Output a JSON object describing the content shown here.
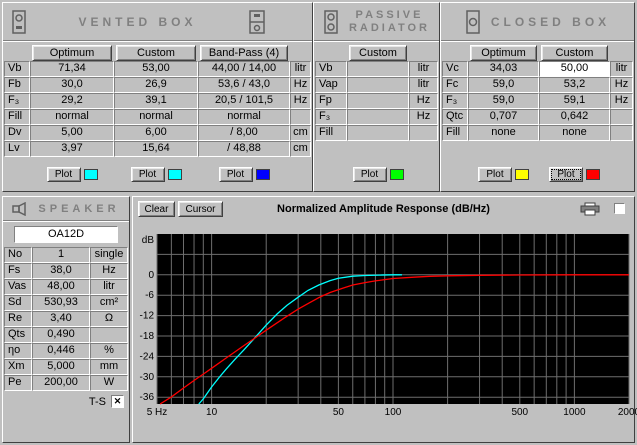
{
  "vented": {
    "title": "VENTED BOX",
    "col_buttons": [
      "Optimum",
      "Custom",
      "Band-Pass (4)"
    ],
    "rows": [
      {
        "label": "Vb",
        "v": [
          "71,34",
          "53,00",
          "44,00 / 14,00"
        ],
        "unit": "litr"
      },
      {
        "label": "Fb",
        "v": [
          "30,0",
          "26,9",
          "53,6 / 43,0"
        ],
        "unit": "Hz"
      },
      {
        "label": "F₃",
        "v": [
          "29,2",
          "39,1",
          "20,5 / 101,5"
        ],
        "unit": "Hz"
      },
      {
        "label": "Fill",
        "v": [
          "normal",
          "normal",
          "normal"
        ],
        "unit": ""
      },
      {
        "label": "Dv",
        "v": [
          "5,00",
          "6,00",
          "/ 8,00"
        ],
        "unit": "cm"
      },
      {
        "label": "Lv",
        "v": [
          "3,97",
          "15,64",
          "/ 48,88"
        ],
        "unit": "cm"
      }
    ],
    "plot_label": "Plot",
    "plot_colors": [
      "#00ffff",
      "#00ffff",
      "#0000ff"
    ]
  },
  "passive": {
    "title_line1": "PASSIVE",
    "title_line2": "RADIATOR",
    "col_buttons": [
      "Custom"
    ],
    "rows": [
      {
        "label": "Vb",
        "v": [
          ""
        ],
        "unit": "litr"
      },
      {
        "label": "Vap",
        "v": [
          ""
        ],
        "unit": "litr"
      },
      {
        "label": "Fp",
        "v": [
          ""
        ],
        "unit": "Hz"
      },
      {
        "label": "F₃",
        "v": [
          ""
        ],
        "unit": "Hz"
      },
      {
        "label": "Fill",
        "v": [
          ""
        ],
        "unit": ""
      }
    ],
    "plot_label": "Plot",
    "plot_colors": [
      "#00ff00"
    ]
  },
  "closed": {
    "title": "CLOSED BOX",
    "col_buttons": [
      "Optimum",
      "Custom"
    ],
    "rows": [
      {
        "label": "Vc",
        "v": [
          "34,03",
          "50,00"
        ],
        "unit": "litr"
      },
      {
        "label": "Fc",
        "v": [
          "59,0",
          "53,2"
        ],
        "unit": "Hz"
      },
      {
        "label": "F₃",
        "v": [
          "59,0",
          "59,1"
        ],
        "unit": "Hz"
      },
      {
        "label": "Qtc",
        "v": [
          "0,707",
          "0,642"
        ],
        "unit": ""
      },
      {
        "label": "Fill",
        "v": [
          "none",
          "none"
        ],
        "unit": ""
      }
    ],
    "plot_label": "Plot",
    "plot_colors": [
      "#ffff00",
      "#ff0000"
    ]
  },
  "speaker": {
    "title": "SPEAKER",
    "name": "OA12D",
    "rows": [
      {
        "label": "No",
        "v": "1",
        "unit": "single"
      },
      {
        "label": "Fs",
        "v": "38,0",
        "unit": "Hz"
      },
      {
        "label": "Vas",
        "v": "48,00",
        "unit": "litr"
      },
      {
        "label": "Sd",
        "v": "530,93",
        "unit": "cm²"
      },
      {
        "label": "Re",
        "v": "3,40",
        "unit": "Ω"
      },
      {
        "label": "Qts",
        "v": "0,490",
        "unit": ""
      },
      {
        "label": "ηo",
        "v": "0,446",
        "unit": "%"
      },
      {
        "label": "Xm",
        "v": "5,000",
        "unit": "mm"
      },
      {
        "label": "Pe",
        "v": "200,00",
        "unit": "W"
      }
    ],
    "ts_label": "T-S",
    "ts_checked": "✕"
  },
  "graph": {
    "clear_label": "Clear",
    "cursor_label": "Cursor"
  },
  "chart_data": {
    "type": "line",
    "title": "Normalized Amplitude Response (dB/Hz)",
    "ylabel": "dB",
    "xscale": "log",
    "xlim": [
      5,
      2000
    ],
    "ylim": [
      -38,
      12
    ],
    "yticks": [
      0,
      -6,
      -12,
      -18,
      -24,
      -30,
      -36
    ],
    "xticks": [
      {
        "v": 5,
        "label": "5 Hz"
      },
      {
        "v": 10,
        "label": "10"
      },
      {
        "v": 50,
        "label": "50"
      },
      {
        "v": 100,
        "label": "100"
      },
      {
        "v": 500,
        "label": "500"
      },
      {
        "v": 1000,
        "label": "1000"
      },
      {
        "v": 2000,
        "label": "2000"
      }
    ],
    "grid": true,
    "plot_bg": "#000000",
    "grid_color": "#6e6e6e",
    "legend_position": "none",
    "series": [
      {
        "name": "vented-box-response",
        "color": "#00ffff",
        "points": [
          [
            8.5,
            -38
          ],
          [
            9,
            -36.5
          ],
          [
            10,
            -33
          ],
          [
            11,
            -30.2
          ],
          [
            12,
            -27.8
          ],
          [
            13.5,
            -24.8
          ],
          [
            15,
            -22.2
          ],
          [
            17,
            -19
          ],
          [
            20,
            -14.8
          ],
          [
            23,
            -11.5
          ],
          [
            26,
            -9
          ],
          [
            30,
            -6.6
          ],
          [
            34,
            -4.6
          ],
          [
            39,
            -3
          ],
          [
            45,
            -1.7
          ],
          [
            50,
            -1
          ],
          [
            60,
            -0.4
          ],
          [
            70,
            -0.2
          ],
          [
            85,
            -0.1
          ],
          [
            100,
            0
          ],
          [
            112,
            0
          ]
        ]
      },
      {
        "name": "closed-box-response",
        "color": "#ff0000",
        "points": [
          [
            5.2,
            -38
          ],
          [
            6,
            -35.9
          ],
          [
            7,
            -33.3
          ],
          [
            8,
            -31.1
          ],
          [
            9,
            -29.2
          ],
          [
            10,
            -27.5
          ],
          [
            12,
            -24.5
          ],
          [
            15,
            -20.9
          ],
          [
            18,
            -18
          ],
          [
            20,
            -16.3
          ],
          [
            25,
            -12.8
          ],
          [
            30,
            -10.1
          ],
          [
            35,
            -8.1
          ],
          [
            40,
            -6.4
          ],
          [
            45,
            -5.2
          ],
          [
            53,
            -3.9
          ],
          [
            60,
            -3
          ],
          [
            70,
            -2.3
          ],
          [
            80,
            -1.8
          ],
          [
            100,
            -1.1
          ],
          [
            130,
            -0.7
          ],
          [
            160,
            -0.45
          ],
          [
            200,
            -0.3
          ],
          [
            300,
            -0.15
          ],
          [
            500,
            -0.05
          ],
          [
            1000,
            0
          ],
          [
            2000,
            0
          ]
        ]
      }
    ]
  }
}
